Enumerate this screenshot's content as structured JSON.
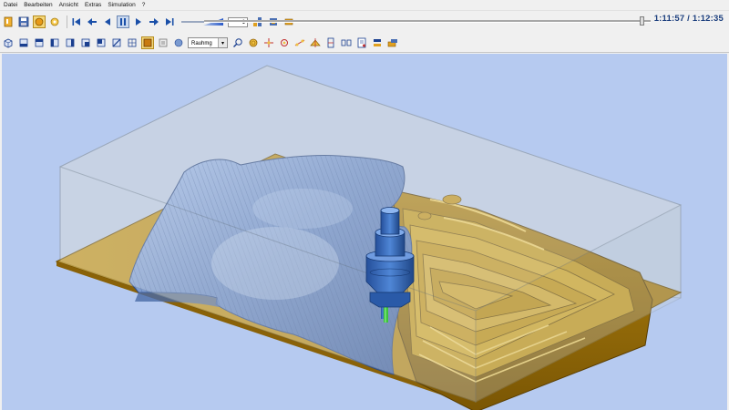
{
  "menu": [
    "Datei",
    "Bearbeiten",
    "Ansicht",
    "Extras",
    "Simulation",
    "?"
  ],
  "toolbar1": {
    "speed_value": "1",
    "time_current": "1:11:57",
    "time_separator": "/",
    "time_total": "1:12:35",
    "progress_fraction": 0.985,
    "buttons": [
      {
        "name": "open-icon"
      },
      {
        "name": "save-icon"
      },
      {
        "name": "stock-view-icon"
      },
      {
        "name": "skip-start-icon"
      },
      {
        "name": "step-back-icon"
      },
      {
        "name": "play-reverse-icon"
      },
      {
        "name": "pause-icon"
      },
      {
        "name": "play-icon"
      },
      {
        "name": "step-forward-icon"
      },
      {
        "name": "skip-end-icon"
      }
    ]
  },
  "toolbar2": {
    "shading_mode": "Rauhmg",
    "views": [
      "iso-view-icon",
      "front-view-icon",
      "top-view-icon",
      "side-view-icon",
      "back-view-icon",
      "right-view-icon",
      "left-view-icon",
      "bottom-view-icon",
      "wireframe-icon",
      "shaded-icon"
    ]
  },
  "scene": {
    "background_color": "#b6caf0",
    "stock_color": "#b88f20",
    "part_color": "#6f8fc7",
    "tool_color": "#3f72c0",
    "tool_tip_color": "#3cc23c"
  }
}
